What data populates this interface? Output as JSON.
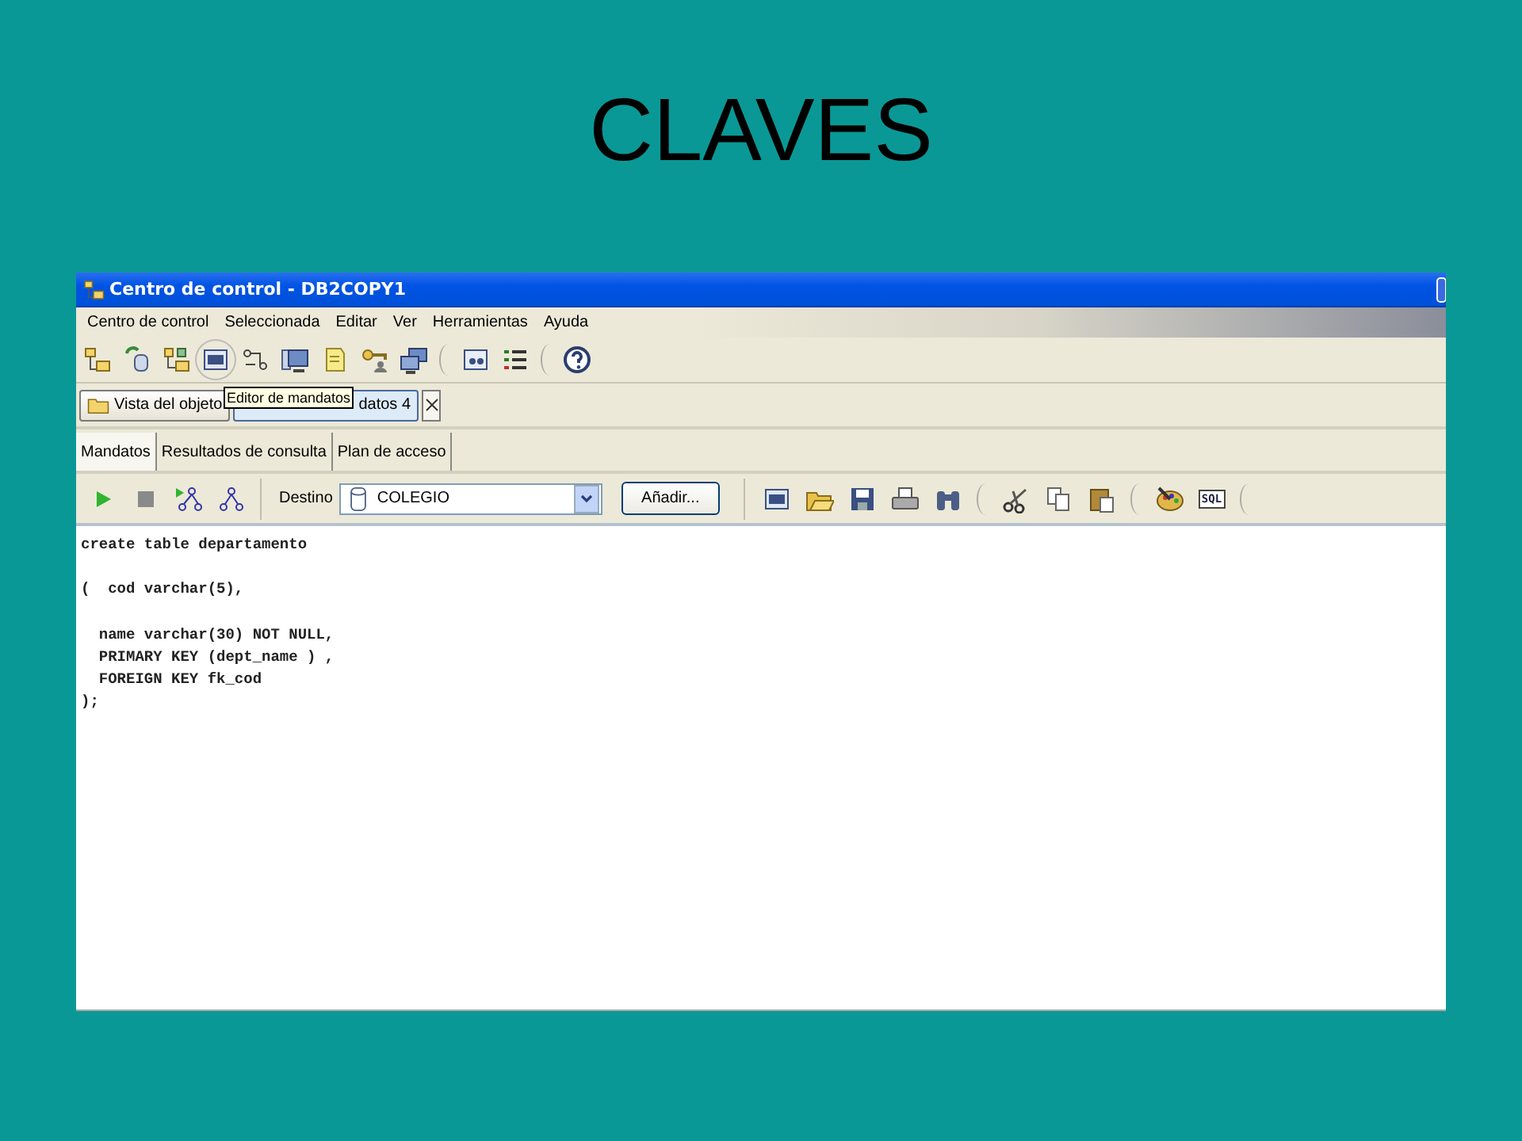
{
  "slide_title": "CLAVES",
  "window": {
    "title": "Centro de control - DB2COPY1",
    "menu": [
      "Centro de control",
      "Seleccionada",
      "Editar",
      "Ver",
      "Herramientas",
      "Ayuda"
    ],
    "object_tabs": [
      {
        "label": "Vista del objeto",
        "selected": false
      },
      {
        "label": "datos 4",
        "selected": true
      }
    ],
    "tooltip": "Editor de mandatos",
    "editor_tabs": [
      {
        "label": "Mandatos",
        "selected": true
      },
      {
        "label": "Resultados de consulta",
        "selected": false
      },
      {
        "label": "Plan de acceso",
        "selected": false
      }
    ],
    "target_label": "Destino",
    "target_value": "COLEGIO",
    "add_button": "Añadir...",
    "sql_icon_text": "SQL",
    "editor_text": "create table departamento\n\n(  cod varchar(5),\n\n  name varchar(30) NOT NULL,\n  PRIMARY KEY (dept_name ) ,\n  FOREIGN KEY fk_cod\n);"
  }
}
